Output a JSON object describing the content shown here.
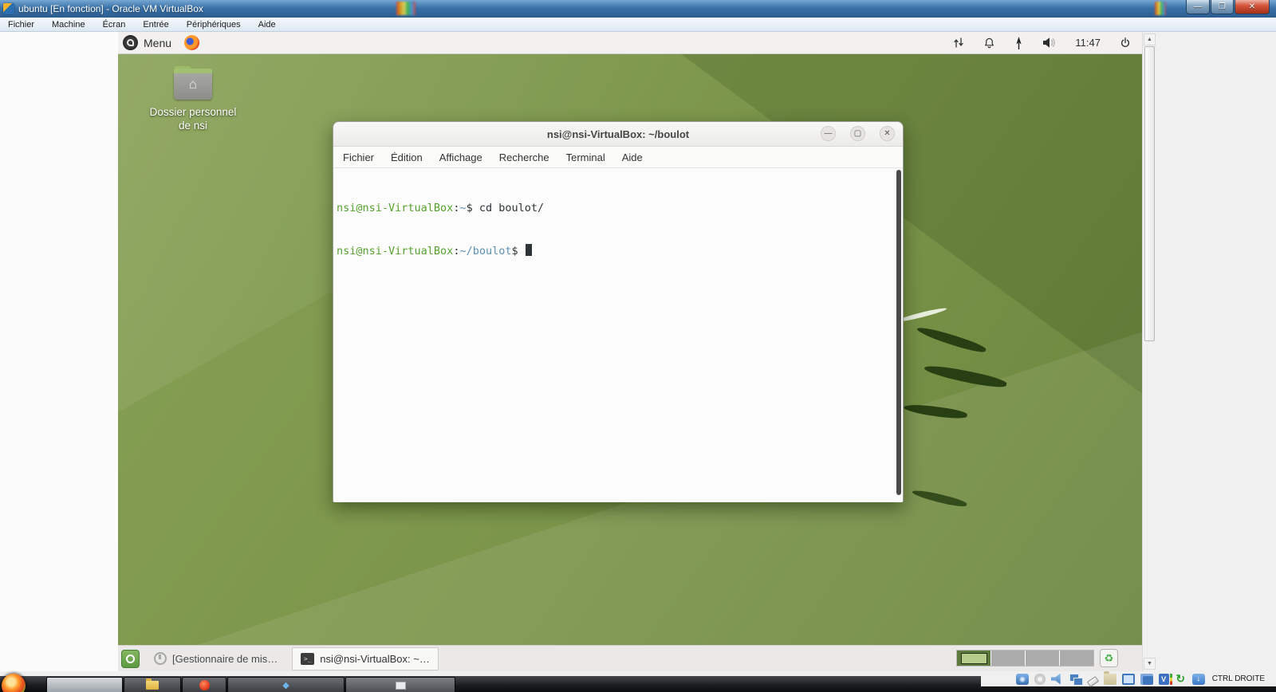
{
  "host": {
    "title": "ubuntu [En fonction] - Oracle VM VirtualBox",
    "menu": [
      "Fichier",
      "Machine",
      "Écran",
      "Entrée",
      "Périphériques",
      "Aide"
    ],
    "window_controls": {
      "minimize": "—",
      "maximize": "❐",
      "close": "✕"
    },
    "status": {
      "host_key": "CTRL DROITE",
      "icons": [
        "hdd",
        "optical-disc",
        "audio",
        "network",
        "usb",
        "shared-folders",
        "display",
        "recording",
        "features",
        "mouse-integration",
        "host-key-state"
      ]
    }
  },
  "guest": {
    "panel": {
      "menu_label": "Menu",
      "clock": "11:47"
    },
    "desktop_icon": {
      "line1": "Dossier personnel",
      "line2": "de nsi"
    },
    "terminal": {
      "title": "nsi@nsi-VirtualBox: ~/boulot",
      "menu": [
        "Fichier",
        "Édition",
        "Affichage",
        "Recherche",
        "Terminal",
        "Aide"
      ],
      "window_controls": {
        "minimize": "—",
        "maximize": "▢",
        "close": "✕"
      },
      "prompt1": {
        "user": "nsi@nsi-VirtualBox",
        "colon": ":",
        "path": "~",
        "dollar": "$",
        "command": " cd boulot/"
      },
      "prompt2": {
        "user": "nsi@nsi-VirtualBox",
        "colon": ":",
        "path": "~/boulot",
        "dollar": "$ "
      }
    },
    "taskbar": {
      "task1": "[Gestionnaire de mis…",
      "task2": "nsi@nsi-VirtualBox: ~…"
    }
  },
  "icons": {
    "scroll_up": "▲",
    "scroll_down": "▼",
    "recycle": "♻",
    "home": "⌂",
    "mouse_integration": "↻",
    "host_key_arrow": "↓",
    "features_v": "V",
    "terminal_glyph": ">_"
  },
  "colors": {
    "prompt_green": "#56a12e",
    "path_blue": "#5b92b4",
    "terminal_text": "#2e3436",
    "wallpaper_green": "#7a9449",
    "titlebar_blue": "#3a72a8"
  }
}
